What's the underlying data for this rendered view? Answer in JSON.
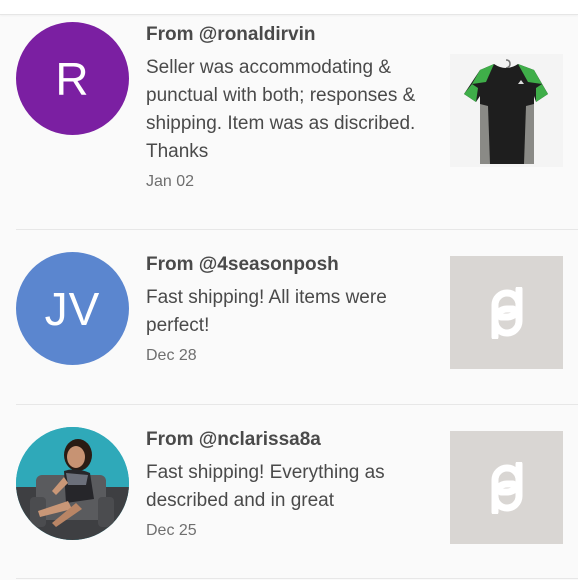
{
  "reviews": [
    {
      "from_prefix": "From ",
      "handle": "@ronaldirvin",
      "text": "Seller was accommodating & punctual with both; responses & shipping. Item was as discribed. Thanks",
      "date": "Jan 02",
      "avatar_initials": "R",
      "avatar_color": "#7b1fa2",
      "thumbnail": "black-green-tshirt-photo"
    },
    {
      "from_prefix": "From ",
      "handle": "@4seasonposh",
      "text": "Fast shipping! All items were perfect!",
      "date": "Dec 28",
      "avatar_initials": "JV",
      "avatar_color": "#5b86cf",
      "thumbnail": "poshmark-logo-icon"
    },
    {
      "from_prefix": "From ",
      "handle": "@nclarissa8a",
      "text": "Fast shipping! Everything as described and in great",
      "date": "Dec 25",
      "avatar_initials": "",
      "avatar_color": "#2aa7b8",
      "thumbnail": "poshmark-logo-icon"
    }
  ]
}
